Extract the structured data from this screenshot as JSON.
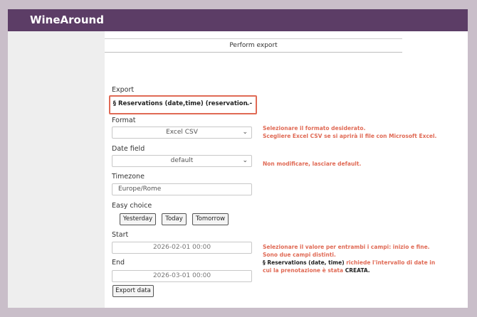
{
  "app": {
    "title": "WineAround"
  },
  "header": {
    "title": "Perform export"
  },
  "form": {
    "export_label": "Export",
    "export_value": "§ Reservations (date,time) (reservation -",
    "format_label": "Format",
    "format_value": "Excel CSV",
    "date_field_label": "Date field",
    "date_field_value": "default",
    "timezone_label": "Timezone",
    "timezone_value": "Europe/Rome",
    "easy_choice_label": "Easy choice",
    "easy_buttons": [
      "Yesterday",
      "Today",
      "Tomorrow"
    ],
    "start_label": "Start",
    "start_value": "2026-02-01 00:00",
    "end_label": "End",
    "end_value": "2026-03-01 00:00",
    "export_button": "Export data"
  },
  "annotations": {
    "format_line1": "Selezionare il formato desiderato.",
    "format_line2": "Scegliere Excel CSV se si aprirà il file con Microsoft Excel.",
    "date_field": "Non modificare, lasciare default.",
    "range_line1": "Selezionare il valore per entrambi i campi: inizio e fine.",
    "range_line2": "Sono due campi distinti.",
    "range_line3_bold": "§ Reservations (date, time)",
    "range_line3_rest": " richiede l'intervallo di date in",
    "range_line4": "cui la prenotazione è stata ",
    "range_line4_bold": "CREATA."
  },
  "colors": {
    "topbar": "#5c3d66",
    "annotation": "#e06a55",
    "highlight": "#e06a55"
  },
  "icons": {
    "dropdown": "chevron-down-icon"
  }
}
